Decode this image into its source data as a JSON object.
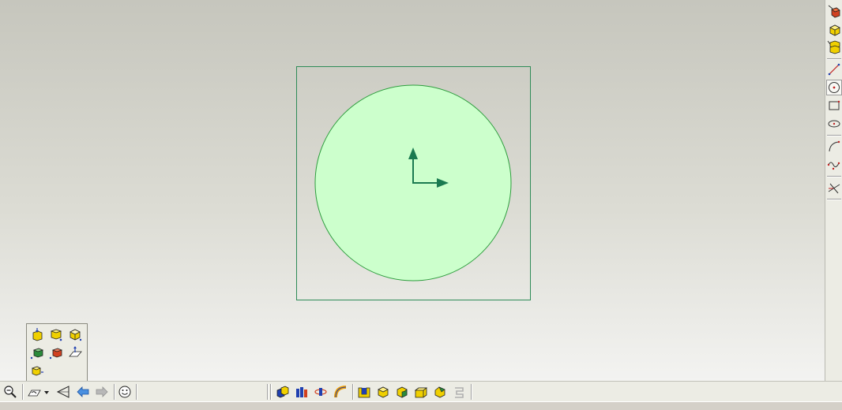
{
  "app": {
    "window_title": ""
  },
  "viewport": {
    "background_top": "#c6c6bd",
    "background_bottom": "#f3f3f1",
    "sketch": {
      "frame_color": "#2e8b57",
      "circle_fill": "#ccffcc",
      "circle_stroke": "#2e9e3e",
      "axis_color": "#1a7a50",
      "shape": "circle",
      "axes": [
        "x-axis-arrow",
        "y-axis-arrow"
      ]
    }
  },
  "right_toolbar": {
    "items": [
      {
        "icon": "part-design-icon"
      },
      {
        "icon": "pad-icon"
      },
      {
        "icon": "multi-pad-icon"
      },
      {
        "icon": "line-icon"
      },
      {
        "icon": "circle-icon",
        "active": true
      },
      {
        "icon": "rectangle-icon"
      },
      {
        "icon": "ellipse-icon"
      },
      {
        "icon": "arc-icon"
      },
      {
        "icon": "spline-icon"
      },
      {
        "icon": "constraint-icon"
      }
    ]
  },
  "floating_palette": {
    "items": [
      {
        "icon": "view-top-icon"
      },
      {
        "icon": "view-front-icon"
      },
      {
        "icon": "view-iso-icon"
      },
      {
        "icon": "view-left-icon"
      },
      {
        "icon": "view-right-icon"
      },
      {
        "icon": "view-plane-icon"
      },
      {
        "icon": "view-bottom-icon"
      }
    ]
  },
  "bottom_toolbar": {
    "items": [
      {
        "icon": "zoom-out-icon"
      },
      {
        "icon": "sketch-plane-icon"
      },
      {
        "icon": "dropdown-arrow-icon"
      },
      {
        "icon": "normal-view-icon"
      },
      {
        "icon": "undo-arrow-icon"
      },
      {
        "icon": "redo-arrow-icon"
      },
      {
        "icon": "smiley-icon"
      },
      {
        "icon": "boolean-icon"
      },
      {
        "icon": "multi-section-icon"
      },
      {
        "icon": "shaft-icon"
      },
      {
        "icon": "rib-icon"
      },
      {
        "icon": "pocket-icon"
      },
      {
        "icon": "pad-solid-icon"
      },
      {
        "icon": "fillet-icon"
      },
      {
        "icon": "box-icon"
      },
      {
        "icon": "chamfer-icon"
      },
      {
        "icon": "disabled-icon"
      }
    ]
  },
  "colors": {
    "toolbar_bg": "#ecece4",
    "icon_yellow": "#f0d000",
    "icon_red": "#d04020",
    "icon_blue": "#2040b0",
    "icon_green": "#2a8a3a"
  }
}
